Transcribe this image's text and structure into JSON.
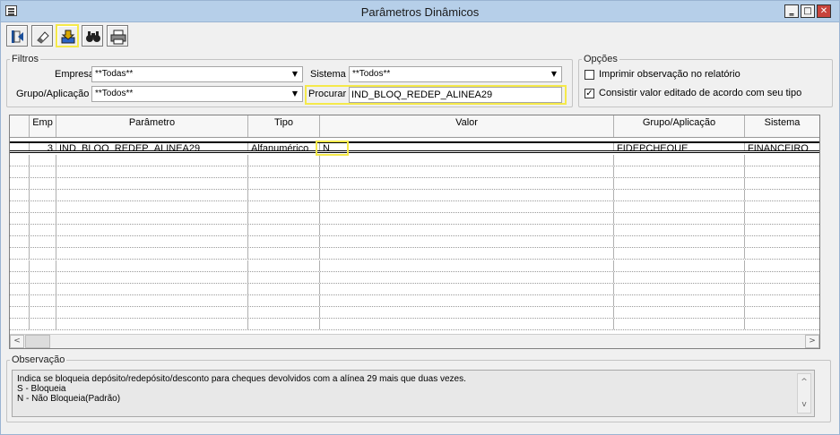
{
  "window": {
    "title": "Parâmetros Dinâmicos"
  },
  "titlebar": {
    "min": "‗",
    "max": "□",
    "close": "✕"
  },
  "toolbar": {
    "buttons": [
      "exit-icon",
      "eraser-icon",
      "save-icon",
      "binoculars-icon",
      "print-icon"
    ]
  },
  "filtros": {
    "legend": "Filtros",
    "empresa_label": "Empresa",
    "empresa_value": "**Todas**",
    "sistema_label": "Sistema",
    "sistema_value": "**Todos**",
    "grupo_label": "Grupo/Aplicação",
    "grupo_value": "**Todos**",
    "procurar_label": "Procurar",
    "procurar_value": "IND_BLOQ_REDEP_ALINEA29"
  },
  "opcoes": {
    "legend": "Opções",
    "imprimir_label": "Imprimir observação no relatório",
    "imprimir_checked": "",
    "consistir_label": "Consistir valor editado de acordo com seu tipo",
    "consistir_checked": "✓"
  },
  "grid": {
    "headers": [
      "Emp",
      "Parâmetro",
      "Tipo",
      "Valor",
      "Grupo/Aplicação",
      "Sistema"
    ],
    "rows": [
      {
        "emp": "3",
        "parametro": "IND_BLOQ_REDEP_ALINEA29",
        "tipo": "Alfanumérico",
        "valor": "N",
        "grupo": "FIDEPCHEQUE",
        "sistema": "FINANCEIRO"
      }
    ]
  },
  "observacao": {
    "legend": "Observação",
    "lines": [
      "Indica se bloqueia depósito/redepósito/desconto para cheques devolvidos com a alínea 29 mais que duas vezes.",
      "S - Bloqueia",
      "N - Não Bloqueia(Padrão)"
    ]
  }
}
